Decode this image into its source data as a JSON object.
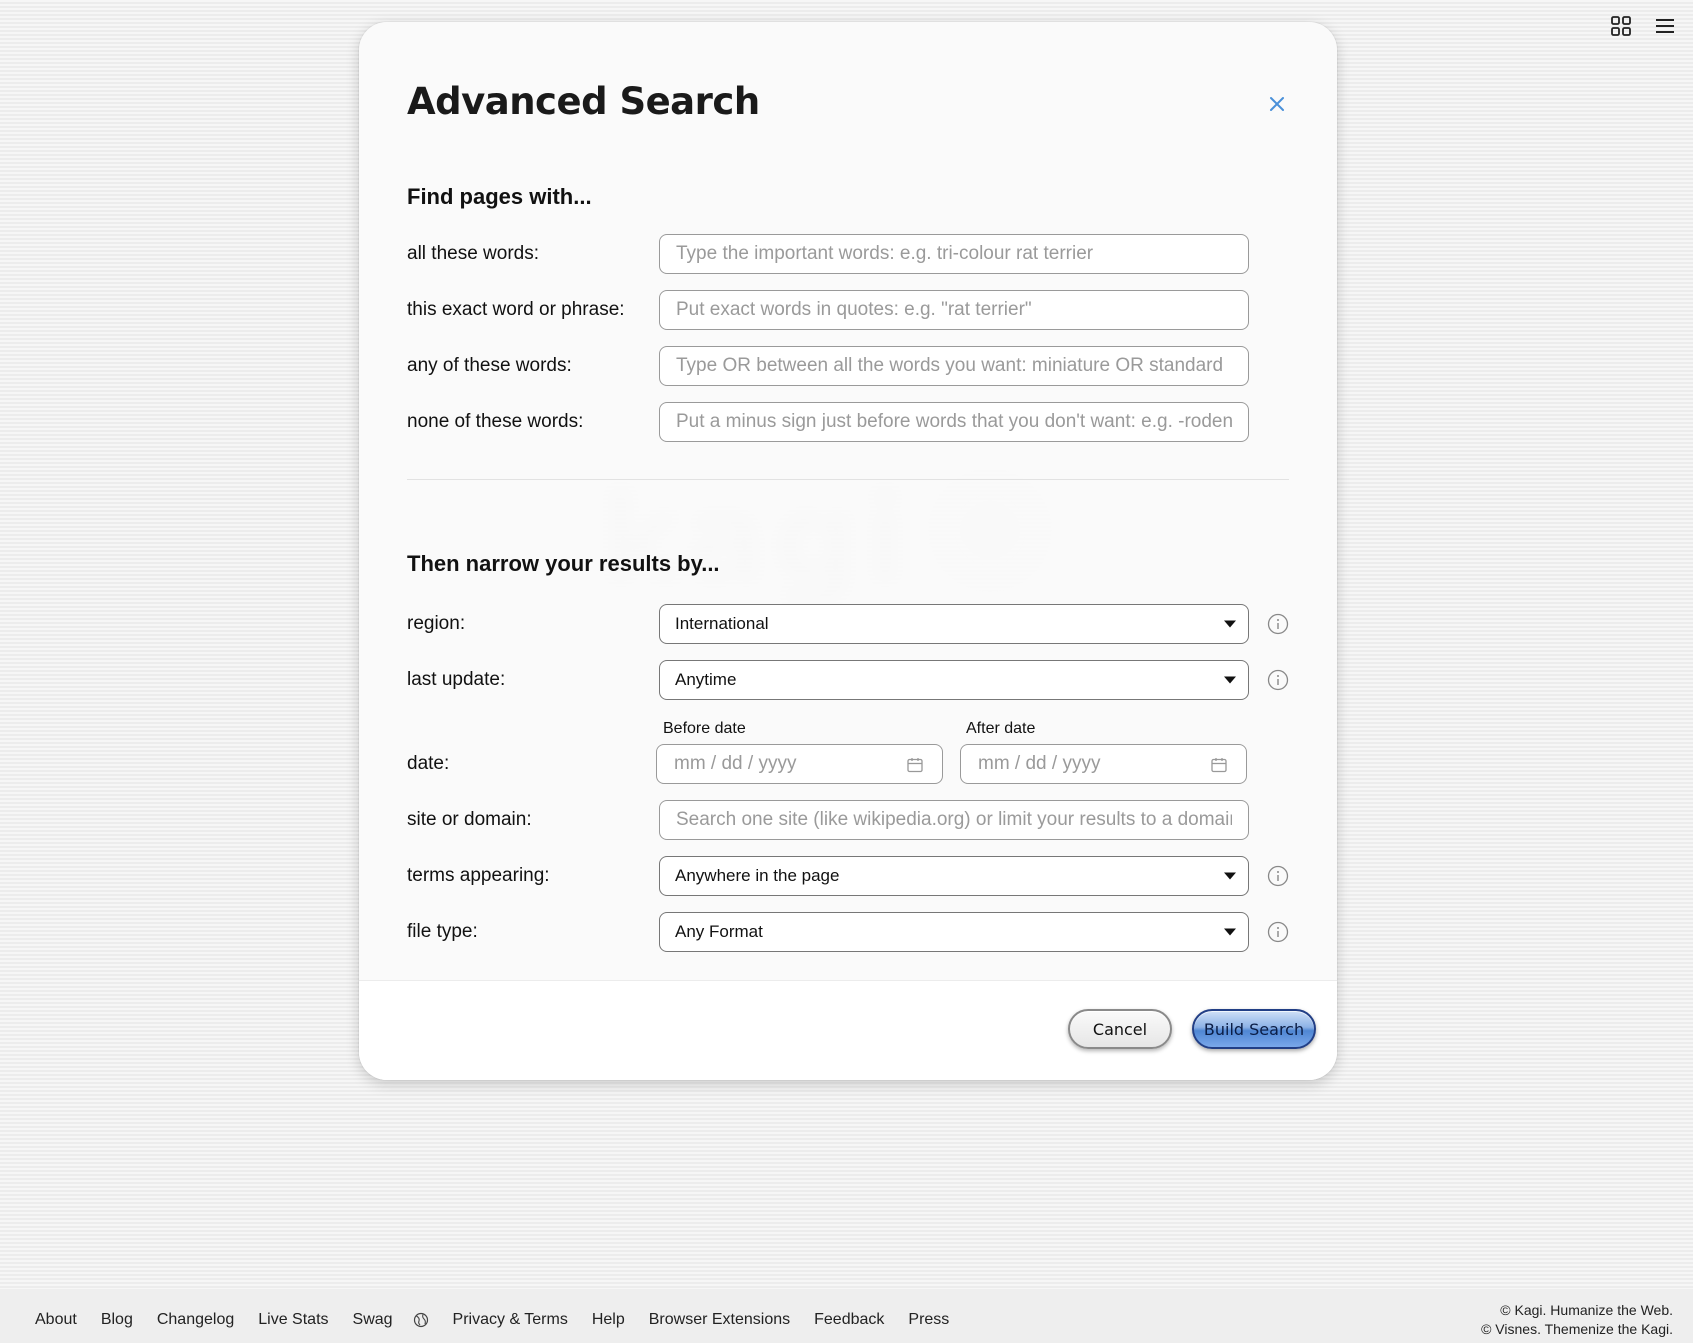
{
  "top_icons": {
    "apps": "apps-grid-icon",
    "menu": "hamburger-menu-icon"
  },
  "modal": {
    "title": "Advanced Search",
    "close_icon": "close-icon",
    "find_section": {
      "title": "Find pages with...",
      "rows": [
        {
          "label": "all these words:",
          "placeholder": "Type the important words: e.g. tri-colour rat terrier",
          "value": ""
        },
        {
          "label": "this exact word or phrase:",
          "placeholder": "Put exact words in quotes: e.g. \"rat terrier\"",
          "value": ""
        },
        {
          "label": "any of these words:",
          "placeholder": "Type OR between all the words you want: miniature OR standard",
          "value": ""
        },
        {
          "label": "none of these words:",
          "placeholder": "Put a minus sign just before words that you don't want: e.g. -rodent, -\"Jack Russell\"",
          "value": ""
        }
      ]
    },
    "narrow_section": {
      "title": "Then narrow your results by...",
      "region": {
        "label": "region:",
        "value": "International"
      },
      "last_update": {
        "label": "last update:",
        "value": "Anytime"
      },
      "date": {
        "label": "date:",
        "before_caption": "Before date",
        "after_caption": "After date",
        "placeholder": "mm / dd / yyyy"
      },
      "site": {
        "label": "site or domain:",
        "placeholder": "Search one site (like wikipedia.org) or limit your results to a domain like .edu, .org or .gov",
        "value": ""
      },
      "terms_appearing": {
        "label": "terms appearing:",
        "value": "Anywhere in the page"
      },
      "file_type": {
        "label": "file type:",
        "value": "Any Format"
      }
    },
    "footer": {
      "cancel_label": "Cancel",
      "build_label": "Build Search"
    }
  },
  "background": {
    "logo_text": "kagi"
  },
  "page_footer": {
    "links": [
      "About",
      "Blog",
      "Changelog",
      "Live Stats",
      "Swag"
    ],
    "links_after": [
      "Privacy & Terms",
      "Help",
      "Browser Extensions",
      "Feedback",
      "Press"
    ],
    "copyright_1": "© Kagi. Humanize the Web.",
    "copyright_2": "© Visnes. Themenize the Kagi."
  },
  "colors": {
    "accent_blue": "#4f86d3",
    "close_icon": "#4a90d9"
  }
}
